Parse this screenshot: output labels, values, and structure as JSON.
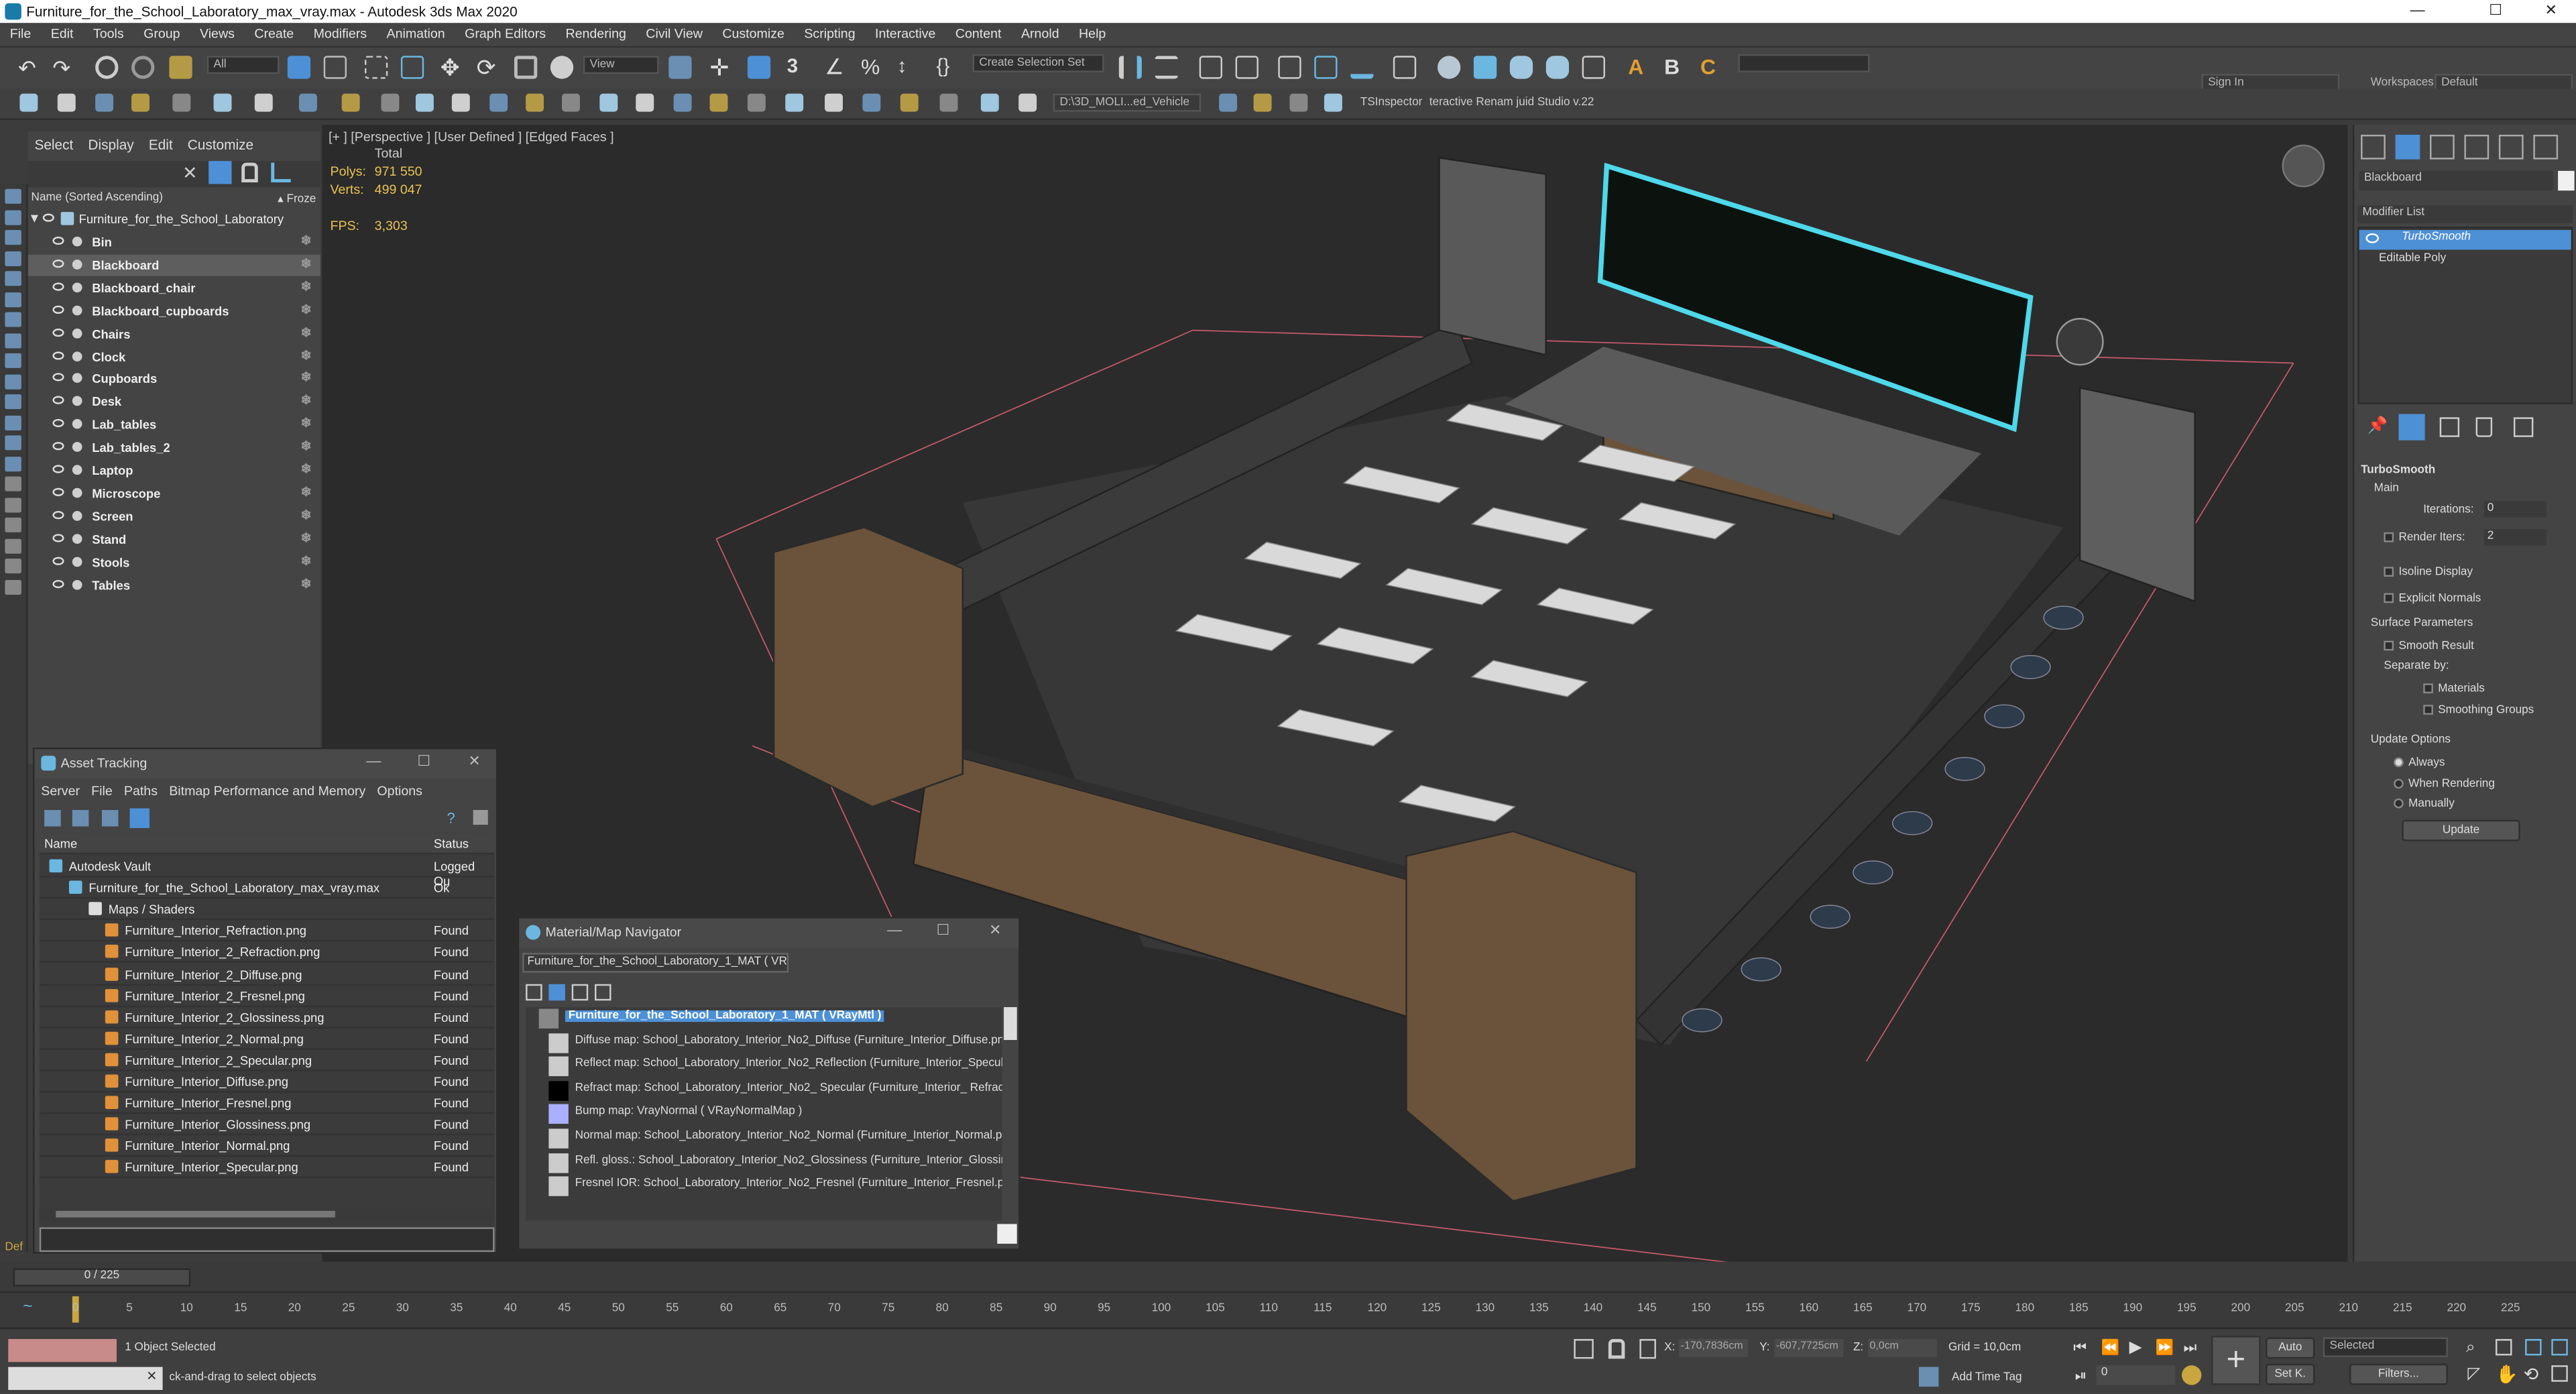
{
  "window": {
    "title": "Furniture_for_the_School_Laboratory_max_vray.max - Autodesk 3ds Max 2020",
    "controls": [
      "—",
      "☐",
      "✕"
    ]
  },
  "menu": [
    "File",
    "Edit",
    "Tools",
    "Group",
    "Views",
    "Create",
    "Modifiers",
    "Animation",
    "Graph Editors",
    "Rendering",
    "Civil View",
    "Customize",
    "Scripting",
    "Interactive",
    "Content",
    "Arnold",
    "Help"
  ],
  "toolbar": {
    "filter": "All",
    "view_combo": "View",
    "selection_set": "Create Selection Set",
    "sign_in": "Sign In",
    "workspaces_label": "Workspaces:",
    "workspace": "Default",
    "project_path": "D:\\3D_MOLI...ed_Vehicle",
    "plugin1": "TSInspector",
    "plugin2": "teractive Renam juid Studio v.22"
  },
  "scene_explorer": {
    "tabs": [
      "Select",
      "Display",
      "Edit",
      "Customize"
    ],
    "column": "Name (Sorted Ascending)",
    "frozen": "▴ Froze",
    "root": "Furniture_for_the_School_Laboratory",
    "items": [
      "Bin",
      "Blackboard",
      "Blackboard_chair",
      "Blackboard_cupboards",
      "Chairs",
      "Clock",
      "Cupboards",
      "Desk",
      "Lab_tables",
      "Lab_tables_2",
      "Laptop",
      "Microscope",
      "Screen",
      "Stand",
      "Stools",
      "Tables"
    ],
    "selected": "Blackboard"
  },
  "viewport": {
    "label": "[+ ] [Perspective ] [User Defined ] [Edged Faces ]",
    "total": "Total",
    "polys_label": "Polys:",
    "polys": "971 550",
    "verts_label": "Verts:",
    "verts": "499 047",
    "fps_label": "FPS:",
    "fps": "3,303"
  },
  "command_panel": {
    "object_name": "Blackboard",
    "modifier_list": "Modifier List",
    "stack": [
      "TurboSmooth",
      "Editable Poly"
    ],
    "rollout": "TurboSmooth",
    "main": "Main",
    "iterations_label": "Iterations:",
    "iterations": "0",
    "render_iters_label": "Render Iters:",
    "render_iters": "2",
    "isoline": "Isoline Display",
    "explicit": "Explicit Normals",
    "surface": "Surface Parameters",
    "smooth": "Smooth Result",
    "separate": "Separate by:",
    "materials": "Materials",
    "smoothing": "Smoothing Groups",
    "update_options": "Update Options",
    "always": "Always",
    "when_rendering": "When Rendering",
    "manually": "Manually",
    "update": "Update"
  },
  "asset_tracking": {
    "title": "Asset Tracking",
    "menu": [
      "Server",
      "File",
      "Paths",
      "Bitmap Performance and Memory",
      "Options"
    ],
    "col_name": "Name",
    "col_status": "Status",
    "rows": [
      {
        "name": "Autodesk Vault",
        "status": "Logged Ou",
        "indent": 0
      },
      {
        "name": "Furniture_for_the_School_Laboratory_max_vray.max",
        "status": "Ok",
        "indent": 1
      },
      {
        "name": "Maps / Shaders",
        "status": "",
        "indent": 2
      },
      {
        "name": "Furniture_Interior_Refraction.png",
        "status": "Found",
        "indent": 3
      },
      {
        "name": "Furniture_Interior_2_Refraction.png",
        "status": "Found",
        "indent": 3
      },
      {
        "name": "Furniture_Interior_2_Diffuse.png",
        "status": "Found",
        "indent": 3
      },
      {
        "name": "Furniture_Interior_2_Fresnel.png",
        "status": "Found",
        "indent": 3
      },
      {
        "name": "Furniture_Interior_2_Glossiness.png",
        "status": "Found",
        "indent": 3
      },
      {
        "name": "Furniture_Interior_2_Normal.png",
        "status": "Found",
        "indent": 3
      },
      {
        "name": "Furniture_Interior_2_Specular.png",
        "status": "Found",
        "indent": 3
      },
      {
        "name": "Furniture_Interior_Diffuse.png",
        "status": "Found",
        "indent": 3
      },
      {
        "name": "Furniture_Interior_Fresnel.png",
        "status": "Found",
        "indent": 3
      },
      {
        "name": "Furniture_Interior_Glossiness.png",
        "status": "Found",
        "indent": 3
      },
      {
        "name": "Furniture_Interior_Normal.png",
        "status": "Found",
        "indent": 3
      },
      {
        "name": "Furniture_Interior_Specular.png",
        "status": "Found",
        "indent": 3
      }
    ]
  },
  "material_nav": {
    "title": "Material/Map Navigator",
    "field": "Furniture_for_the_School_Laboratory_1_MAT  ( VRayM",
    "rows": [
      "Furniture_for_the_School_Laboratory_1_MAT  ( VRayMtl )",
      "Diffuse map: School_Laboratory_Interior_No2_Diffuse (Furniture_Interior_Diffuse.png)",
      "Reflect map: School_Laboratory_Interior_No2_Reflection (Furniture_Interior_Specular.pr",
      "Refract map: School_Laboratory_Interior_No2_ Specular (Furniture_Interior_ Refraction.",
      "Bump map: VrayNormal  ( VRayNormalMap )",
      "Normal map: School_Laboratory_Interior_No2_Normal (Furniture_Interior_Normal.pn",
      "Refl. gloss.: School_Laboratory_Interior_No2_Glossiness (Furniture_Interior_Glossiness.",
      "Fresnel IOR: School_Laboratory_Interior_No2_Fresnel (Furniture_Interior_Fresnel.png)"
    ]
  },
  "timeline": {
    "frame": "0 / 225",
    "ticks": [
      "0",
      "5",
      "10",
      "15",
      "20",
      "25",
      "30",
      "35",
      "40",
      "45",
      "50",
      "55",
      "60",
      "65",
      "70",
      "75",
      "80",
      "85",
      "90",
      "95",
      "100",
      "105",
      "110",
      "115",
      "120",
      "125",
      "130",
      "135",
      "140",
      "145",
      "150",
      "155",
      "160",
      "165",
      "170",
      "175",
      "180",
      "185",
      "190",
      "195",
      "200",
      "205",
      "210",
      "215",
      "220",
      "225"
    ]
  },
  "status": {
    "selected": "1 Object Selected",
    "hint": "ck-and-drag to select objects",
    "x_label": "X:",
    "x": "-170,7836cm",
    "y_label": "Y:",
    "y": "-607,7725cm",
    "z_label": "Z:",
    "z": "0,0cm",
    "grid": "Grid = 10,0cm",
    "add_time_tag": "Add Time Tag",
    "auto": "Auto",
    "selected_combo": "Selected",
    "set_k": "Set K.",
    "filters": "Filters...",
    "frame_field": "0",
    "left_label": "Def"
  },
  "colors": {
    "accent": "#4d90d6",
    "poly_stat": "#e8c254",
    "selection_bracket": "#c85a6a",
    "blackboard_glow": "#4fd8ea"
  }
}
